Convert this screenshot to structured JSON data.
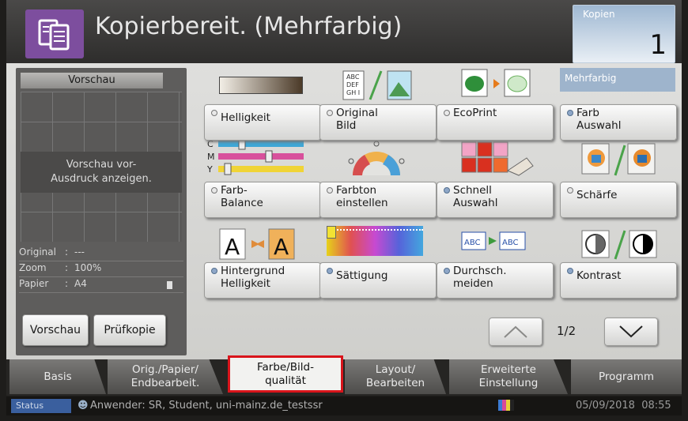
{
  "header": {
    "title": "Kopierbereit. (Mehrfarbig)",
    "copies_label": "Kopien",
    "copies_value": "1",
    "icon": "copy-icon"
  },
  "preview": {
    "title": "Vorschau",
    "message": "Vorschau vor-\nAusdruck anzeigen.",
    "info": [
      {
        "key": "Original",
        "sep": ":",
        "value": "---"
      },
      {
        "key": "Zoom",
        "sep": ":",
        "value": "100%"
      },
      {
        "key": "Papier",
        "sep": ":",
        "value": "A4"
      }
    ],
    "preview_button": "Vorschau",
    "proof_button": "Prüfkopie"
  },
  "color_mode_label": "Mehrfarbig",
  "functions": [
    {
      "label": "Helligkeit",
      "icon": "brightness-gradient-icon",
      "active": false
    },
    {
      "label": "Original\nBild",
      "icon": "original-image-icon",
      "active": false
    },
    {
      "label": "EcoPrint",
      "icon": "ecoprint-icon",
      "active": false
    },
    {
      "label": "Farb\nAuswahl",
      "icon": "color-select-icon",
      "active": true
    },
    {
      "label": "Farb-\nBalance",
      "icon": "color-balance-icon",
      "active": false
    },
    {
      "label": "Farbton\neinstellen",
      "icon": "hue-adjust-icon",
      "active": false
    },
    {
      "label": "Schnell\nAuswahl",
      "icon": "quick-select-icon",
      "active": true
    },
    {
      "label": "Schärfe",
      "icon": "sharpness-icon",
      "active": false
    },
    {
      "label": "Hintergrund\nHelligkeit",
      "icon": "background-density-icon",
      "active": true
    },
    {
      "label": "Sättigung",
      "icon": "saturation-icon",
      "active": true
    },
    {
      "label": "Durchsch.\nmeiden",
      "icon": "prevent-bleed-icon",
      "active": true
    },
    {
      "label": "Kontrast",
      "icon": "contrast-icon",
      "active": true
    }
  ],
  "pagination": {
    "text": "1/2"
  },
  "tabs": [
    {
      "label": "Basis"
    },
    {
      "label": "Orig./Papier/\nEndbearbeit."
    },
    {
      "label": "Farbe/Bild-\nqualität"
    },
    {
      "label": "Layout/\nBearbeiten"
    },
    {
      "label": "Erweiterte\nEinstellung"
    },
    {
      "label": "Programm"
    }
  ],
  "status": {
    "label": "Status",
    "user": "Anwender: SR, Student, uni-mainz.de_testssr",
    "datetime": "05/09/2018  08:55"
  },
  "colors": {
    "accent_purple": "#7d4e9e",
    "highlight_red": "#d9141b",
    "led_blue": "#8ea7c8"
  }
}
